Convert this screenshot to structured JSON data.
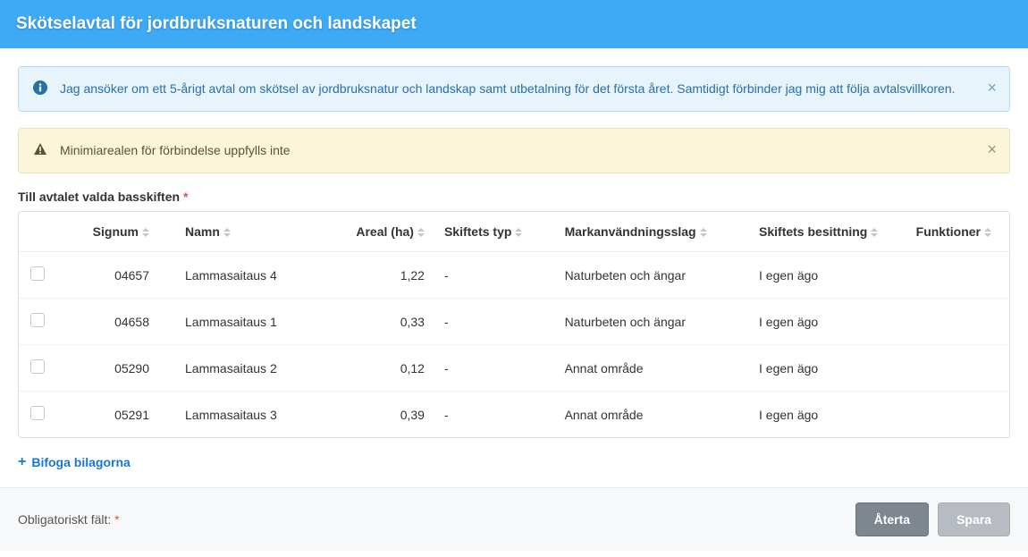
{
  "header": {
    "title": "Skötselavtal för jordbruksnaturen och landskapet"
  },
  "alerts": {
    "info_text": "Jag ansöker om ett 5-årigt avtal om skötsel av jordbruksnatur och landskap samt utbetalning för det första året. Samtidigt förbinder jag mig att följa avtalsvillkoren.",
    "warning_text": "Minimiarealen för förbindelse uppfylls inte"
  },
  "section_label": "Till avtalet valda basskiften",
  "table": {
    "headers": {
      "signum": "Signum",
      "namn": "Namn",
      "areal": "Areal (ha)",
      "typ": "Skiftets typ",
      "mark": "Markanvändningsslag",
      "besittning": "Skiftets besittning",
      "funktioner": "Funktioner"
    },
    "rows": [
      {
        "signum": "04657",
        "namn": "Lammasaitaus 4",
        "areal": "1,22",
        "typ": "-",
        "mark": "Naturbeten och ängar",
        "besittning": "I egen ägo"
      },
      {
        "signum": "04658",
        "namn": "Lammasaitaus 1",
        "areal": "0,33",
        "typ": "-",
        "mark": "Naturbeten och ängar",
        "besittning": "I egen ägo"
      },
      {
        "signum": "05290",
        "namn": "Lammasaitaus 2",
        "areal": "0,12",
        "typ": "-",
        "mark": "Annat område",
        "besittning": "I egen ägo"
      },
      {
        "signum": "05291",
        "namn": "Lammasaitaus 3",
        "areal": "0,39",
        "typ": "-",
        "mark": "Annat område",
        "besittning": "I egen ägo"
      }
    ]
  },
  "attach_link": "Bifoga bilagorna",
  "footer": {
    "label": "Obligatoriskt fält:",
    "revert": "Återta",
    "save": "Spara"
  }
}
